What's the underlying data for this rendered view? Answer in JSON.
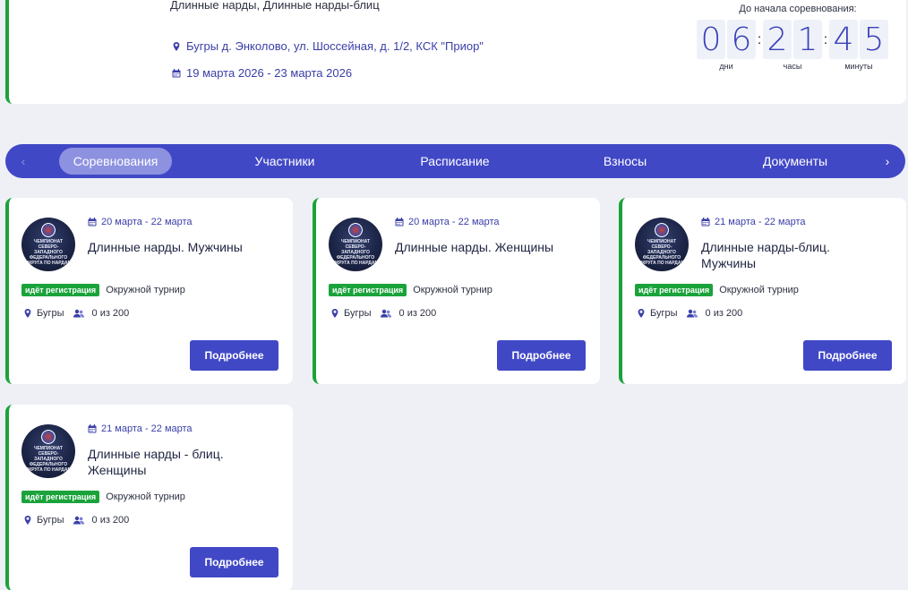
{
  "header": {
    "subtitle": "Длинные нарды, Длинные нарды-блиц",
    "location": "Бугры д. Энколово, ул. Шоссейная, д. 1/2, КСК \"Приор\"",
    "dates": "19 марта 2026 - 23 марта 2026",
    "countdown": {
      "label": "До начала соревнования:",
      "days": [
        "0",
        "6"
      ],
      "hours": [
        "2",
        "1"
      ],
      "minutes": [
        "4",
        "5"
      ],
      "days_label": "дни",
      "hours_label": "часы",
      "minutes_label": "минуты",
      "separator": ":"
    }
  },
  "tabs": {
    "prev": "‹",
    "next": "›",
    "items": [
      {
        "label": "Соревнования",
        "active": true
      },
      {
        "label": "Участники",
        "active": false
      },
      {
        "label": "Расписание",
        "active": false
      },
      {
        "label": "Взносы",
        "active": false
      },
      {
        "label": "Документы",
        "active": false
      }
    ]
  },
  "cards": [
    {
      "dates": "20 марта - 22 марта",
      "title": "Длинные нарды. Мужчины",
      "badge": "идёт регистрация",
      "type": "Окружной турнир",
      "location": "Бугры",
      "participants": "0 из 200",
      "button": "Подробнее",
      "logo_text": "ЧЕМПИОНАТ СЕВЕРО-ЗАПАДНОГО ФЕДЕРАЛЬНОГО ОКРУГА ПО НАРДАМ"
    },
    {
      "dates": "20 марта - 22 марта",
      "title": "Длинные нарды. Женщины",
      "badge": "идёт регистрация",
      "type": "Окружной турнир",
      "location": "Бугры",
      "participants": "0 из 200",
      "button": "Подробнее",
      "logo_text": "ЧЕМПИОНАТ СЕВЕРО-ЗАПАДНОГО ФЕДЕРАЛЬНОГО ОКРУГА ПО НАРДАМ"
    },
    {
      "dates": "21 марта - 22 марта",
      "title": "Длинные нарды-блиц. Мужчины",
      "badge": "идёт регистрация",
      "type": "Окружной турнир",
      "location": "Бугры",
      "participants": "0 из 200",
      "button": "Подробнее",
      "logo_text": "ЧЕМПИОНАТ СЕВЕРО-ЗАПАДНОГО ФЕДЕРАЛЬНОГО ОКРУГА ПО НАРДАМ"
    },
    {
      "dates": "21 марта - 22 марта",
      "title": "Длинные нарды - блиц. Женщины",
      "badge": "идёт регистрация",
      "type": "Окружной турнир",
      "location": "Бугры",
      "participants": "0 из 200",
      "button": "Подробнее",
      "logo_text": "ЧЕМПИОНАТ СЕВЕРО-ЗАПАДНОГО ФЕДЕРАЛЬНОГО ОКРУГА ПО НАРДАМ"
    }
  ],
  "colors": {
    "accent": "#4148c6",
    "status_green": "#1aa33a",
    "background": "#eef0f5"
  }
}
